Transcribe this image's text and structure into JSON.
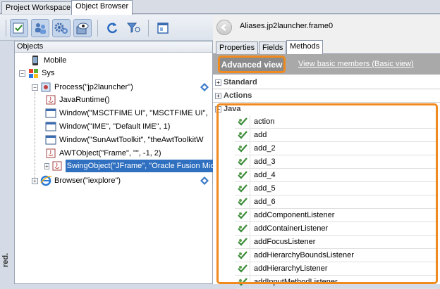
{
  "top_tabs": [
    "Project Workspace",
    "Object Browser"
  ],
  "left_panel": {
    "header": "Objects",
    "side_label": "red.",
    "tree": [
      {
        "label": "Mobile"
      },
      {
        "label": "Sys"
      },
      {
        "label": "Process(\"jp2launcher\")"
      },
      {
        "label": "JavaRuntime()"
      },
      {
        "label": "Window(\"MSCTFIME UI\", \"MSCTFIME UI\","
      },
      {
        "label": "Window(\"IME\", \"Default IME\", 1)"
      },
      {
        "label": "Window(\"SunAwtToolkit\", \"theAwtToolkitW"
      },
      {
        "label": "AWTObject(\"Frame\", \"\", -1, 2)"
      },
      {
        "label": "SwingObject(\"JFrame\", \"Oracle Fusion Mic"
      },
      {
        "label": "Browser(\"iexplore\")"
      }
    ]
  },
  "right_panel": {
    "object_name": "Aliases.jp2launcher.frame0",
    "tabs": [
      "Properties",
      "Fields",
      "Methods"
    ],
    "advanced_view": "Advanced view",
    "basic_view_link": "View basic members (Basic view)",
    "categories": [
      "Standard",
      "Actions",
      "Java"
    ],
    "methods": [
      "action",
      "add",
      "add_2",
      "add_3",
      "add_4",
      "add_5",
      "add_6",
      "addComponentListener",
      "addContainerListener",
      "addFocusListener",
      "addHierarchyBoundsListener",
      "addHierarchyListener",
      "addInputMethodListener"
    ]
  },
  "colors": {
    "highlight": "#f08a1e",
    "selection": "#3070c0"
  }
}
